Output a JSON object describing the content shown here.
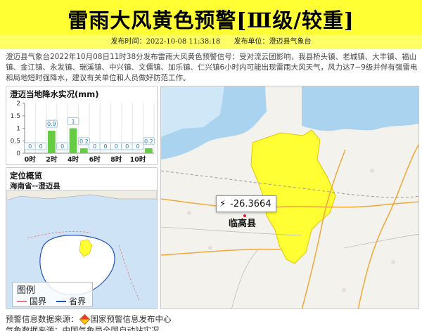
{
  "header": {
    "title": "雷雨大风黄色预警[Ⅲ级/较重]",
    "publish_time": "发布时间：2022-10-08 11:38:18",
    "publisher": "发布单位：澄迈县气象台"
  },
  "description": "澄迈县气象台2022年10月08日11时38分发布雷雨大风黄色预警信号：受对流云团影响，我县桥头镇、老城镇、大丰镇、福山镇、金江镇、永发镇、瑞溪镇、中兴镇、文儒镇、加乐镇、仁兴镇6小时内可能出现雷雨大风天气，风力达7~9级并伴有强雷电和局地短时强降水，建议有关单位和人员做好防范工作。",
  "rain_panel": {
    "title": "澄迈当地降水实况(mm)"
  },
  "chart_data": {
    "type": "bar",
    "title": "澄迈当地降水实况(mm)",
    "categories": [
      "0时",
      "1时",
      "2时",
      "3时",
      "4时",
      "5时",
      "6时",
      "7时",
      "8时",
      "9时",
      "10时",
      "11时"
    ],
    "values": [
      0,
      0,
      0.9,
      0,
      1,
      0.2,
      0,
      0,
      0,
      0,
      0,
      0.2
    ],
    "x_tick_labels": [
      "0时",
      "2时",
      "4时",
      "6时",
      "8时",
      "10时"
    ],
    "y_ticks": [
      0,
      0.5,
      1,
      1.5,
      2
    ],
    "ylim": [
      0,
      2
    ],
    "bar_color": "#66cc44",
    "grid": true
  },
  "overview": {
    "title": "定位概览",
    "subtitle": "海南省--澄迈县",
    "legend_title": "图例",
    "legend_items": [
      {
        "label": "国界",
        "color": "#e27a85"
      },
      {
        "label": "省界",
        "color": "#2255bb"
      }
    ]
  },
  "map": {
    "value_label": "-26.3664",
    "city_name": "临高县",
    "warning_area_color": "#ffff33"
  },
  "footer": {
    "source_prefix": "预警信息数据来源：",
    "source_name": "国家预警信息发布中心",
    "weather_source": "气象数据来源：中国气象局全国自动站实况"
  },
  "colors": {
    "header_bg": "#ffff33",
    "warning_yellow": "#ffff33"
  }
}
